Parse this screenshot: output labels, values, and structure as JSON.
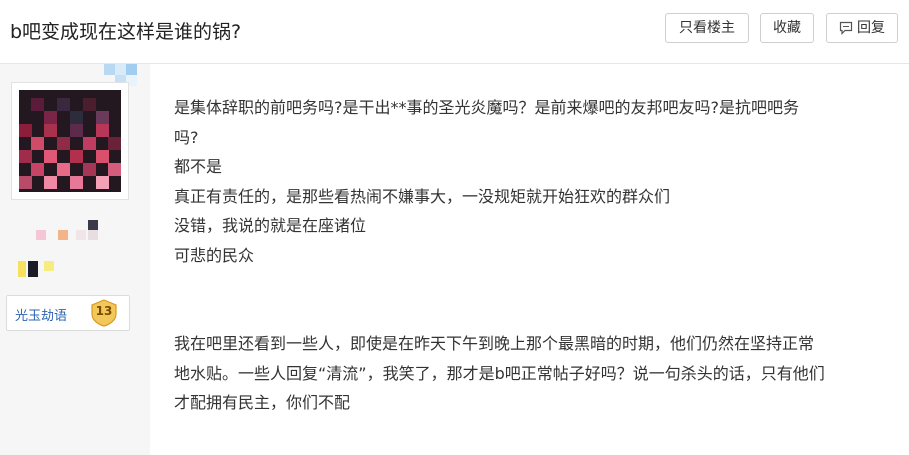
{
  "header": {
    "title": "b吧变成现在这样是谁的锅?",
    "buttons": {
      "only_op": "只看楼主",
      "favorite": "收藏",
      "reply": "回复"
    }
  },
  "author": {
    "name": "光玉劫语",
    "level": "13",
    "avatar_icon": "pixelated-avatar",
    "colors": {
      "name": "#2d64b3",
      "badge": "#f3c85a"
    }
  },
  "post": {
    "para1": [
      "是集体辞职的前吧务吗?是干出**事的圣光炎魔吗？是前来爆吧的友邦吧友吗?是抗吧吧务",
      "吗?",
      "都不是",
      "真正有责任的，是那些看热闹不嫌事大，一没规矩就开始狂欢的群众们",
      "没错，我说的就是在座诸位",
      "可悲的民众"
    ],
    "para2": [
      "我在吧里还看到一些人，即使是在昨天下午到晚上那个最黑暗的时期，他们仍然在坚持正常",
      "地水贴。一些人回复“清流”，我笑了，那才是b吧正常帖子好吗？说一句杀头的话，只有他们",
      "才配拥有民主，你们不配"
    ]
  }
}
